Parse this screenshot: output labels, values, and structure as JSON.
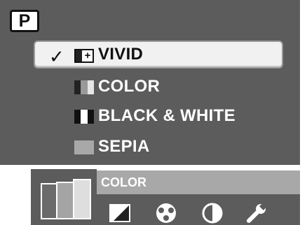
{
  "mode_badge": "P",
  "menu": {
    "selected_check": "✓",
    "items": [
      {
        "label": "VIVID",
        "chip": "vivid-chip-icon",
        "selected": true
      },
      {
        "label": "COLOR",
        "chip": "color-chip-icon",
        "selected": false
      },
      {
        "label": "BLACK & WHITE",
        "chip": "black-white-chip-icon",
        "selected": false
      },
      {
        "label": "SEPIA",
        "chip": "sepia-chip-icon",
        "selected": false
      }
    ]
  },
  "status": {
    "current": "COLOR"
  },
  "bottom_icons": [
    "contrast-icon",
    "color-palette-icon",
    "half-circle-icon",
    "wrench-icon"
  ],
  "colors": {
    "background": "#5c5c5c",
    "status_bar": "#a8a8a8",
    "selected_row": "#f1f1f1",
    "text": "#ffffff"
  }
}
